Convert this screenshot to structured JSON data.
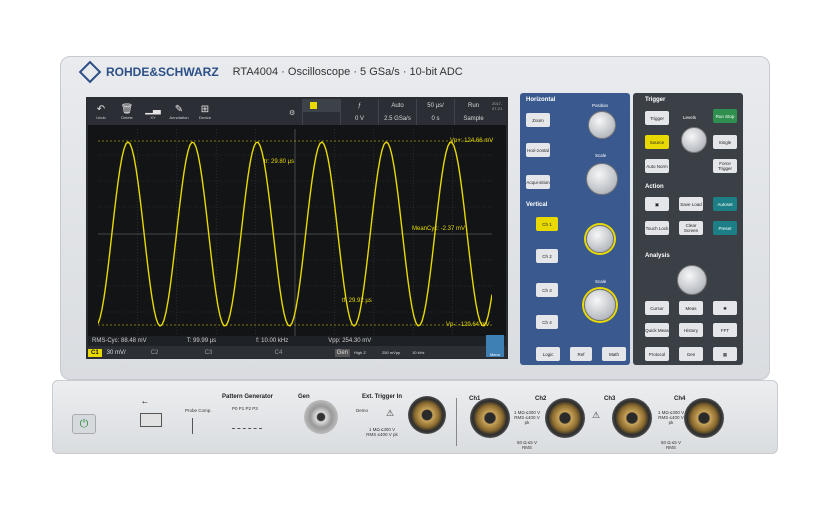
{
  "brand": {
    "name": "ROHDE&SCHWARZ",
    "model": "RTA4004 · Oscilloscope · 5 GSa/s · 10-bit ADC"
  },
  "toolbar": {
    "items": [
      "Undo",
      "Delete",
      "XY",
      "Annotation",
      "Device"
    ],
    "status_top": [
      "",
      "ƒ",
      "Auto",
      "50 µs/",
      "Run"
    ],
    "status_bottom": [
      "0 V",
      "2.5 GSa/s",
      "0 s",
      "Sample"
    ],
    "date": "2017-07-21"
  },
  "screen": {
    "measurements": {
      "vp_plus": "Vp+: 124.66 mV",
      "tr": "tr: 29.80 µs",
      "mean_cyc": "MeanCyc: -2.37 mV",
      "tf": "tf: 29.92 µs",
      "vp_minus": "Vp-: -129.64 mV"
    },
    "status1": [
      "RMS-Cyc: 88.48 mV",
      "T: 99.99 µs",
      "f: 10.00 kHz",
      "Vpp: 254.30 mV"
    ],
    "ch_tags": [
      "C1",
      "C2",
      "C3",
      "C4"
    ],
    "ch1_scale": "30 mV/",
    "gen": "Gen",
    "wave_label": "High Z",
    "gen_values": [
      "250 mVpp",
      "10 kHz"
    ],
    "menu": "Menu",
    "trace_color": "#e8d900"
  },
  "horizontal": {
    "title": "Horizontal",
    "zoom": "Zoom",
    "horizontal": "Hori-zontal",
    "acquisition": "Acqui-sition",
    "position": "Position",
    "scale": "Scale"
  },
  "vertical": {
    "title": "Vertical",
    "ch1": "Ch 1",
    "ch2": "Ch 2",
    "ch3": "Ch 3",
    "ch4": "Ch 4",
    "scale": "Scale",
    "logic": "Logic",
    "ref": "Ref",
    "math": "Math"
  },
  "trigger": {
    "title": "Trigger",
    "trigger": "Trigger",
    "source": "Source",
    "auto_norm": "Auto Norm",
    "levels": "Levels",
    "run_stop": "Run Stop",
    "single": "Single",
    "force_trigger": "Force Trigger"
  },
  "action": {
    "title": "Action",
    "save_load": "Save Load",
    "autoset": "Autoset",
    "touch_lock": "Touch Lock",
    "clear_screen": "Clear Screen",
    "preset": "Preset"
  },
  "analysis": {
    "title": "Analysis",
    "cursor": "Cursor",
    "meas": "Meas",
    "quick_meas": "Quick Meas",
    "history": "History",
    "fft": "FFT",
    "protocol": "Protocol",
    "gen": "Gen"
  },
  "front": {
    "pattern_generator": "Pattern Generator",
    "probe_comp": "Probe Comp.",
    "pins": "P0  P1  P2  P3",
    "gen": "Gen",
    "ext_trigger": "Ext. Trigger In",
    "demo": "Demo",
    "ext_spec": "1 MΩ ≤300 V RMS ≤400 V pk",
    "ch_labels": [
      "Ch1",
      "Ch2",
      "Ch3",
      "Ch4"
    ],
    "ch_spec_a": "1 MΩ ≤300 V RMS ≤400 V pk",
    "ch_spec_b": "50 Ω ≤5 V RMS"
  }
}
